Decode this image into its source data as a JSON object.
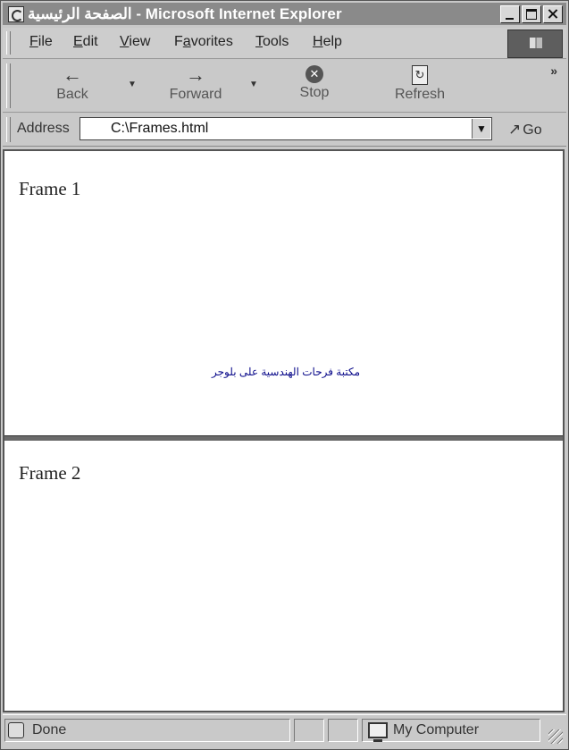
{
  "window": {
    "title": "الصفحة الرئيسية - Microsoft Internet Explorer"
  },
  "menubar": {
    "items": [
      {
        "label": "File",
        "accel": "F",
        "rest": "ile"
      },
      {
        "label": "Edit",
        "accel": "E",
        "rest": "dit"
      },
      {
        "label": "View",
        "accel": "V",
        "rest": "iew"
      },
      {
        "label": "Favorites",
        "accel": "a",
        "pre": "F",
        "rest": "vorites"
      },
      {
        "label": "Tools",
        "accel": "T",
        "rest": "ools"
      },
      {
        "label": "Help",
        "accel": "H",
        "rest": "elp"
      }
    ]
  },
  "toolbar": {
    "back_label": "Back",
    "forward_label": "Forward",
    "stop_label": "Stop",
    "refresh_label": "Refresh",
    "more": "»"
  },
  "addressbar": {
    "label": "Address",
    "value": "C:\\Frames.html",
    "go_label": "Go"
  },
  "frames": {
    "frame1_title": "Frame 1",
    "frame2_title": "Frame 2",
    "watermark": "مكتبة فرحات الهندسية على بلوجر"
  },
  "statusbar": {
    "status_text": "Done",
    "zone_text": "My Computer"
  },
  "icons": {
    "back": "arrow-left-icon",
    "forward": "arrow-right-icon",
    "stop": "stop-icon",
    "refresh": "refresh-icon",
    "go": "go-arrow-icon"
  }
}
